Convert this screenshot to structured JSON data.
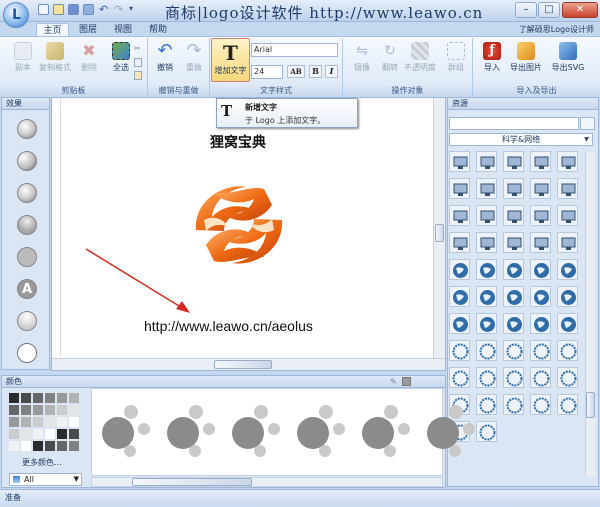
{
  "window": {
    "title": "商标|logo设计软件  http://www.leawo.cn",
    "app_logo_letter": "L",
    "quick_access": [
      "new-icon",
      "open-icon",
      "save-icon",
      "save-as-icon",
      "undo-icon",
      "redo-icon",
      "dropdown-icon"
    ],
    "buttons": {
      "minimize": "–",
      "maximize": "□",
      "close": "✕"
    }
  },
  "ribbon_tabs": [
    "主页",
    "图层",
    "视图",
    "帮助"
  ],
  "active_tab": "主页",
  "help_link": "了解硕思Logo设计师",
  "ribbon": {
    "clipboard": {
      "label": "剪贴板",
      "copy": "副本",
      "format_paint": "复制格式",
      "delete": "删除",
      "select_all": "全选"
    },
    "undo_redo": {
      "label": "撤销与重做",
      "undo": "撤销",
      "redo": "重做"
    },
    "text_style": {
      "label": "文字样式",
      "add_text": "增加文字",
      "font": "Arial",
      "size": "24",
      "ab": "AB",
      "bold": "B",
      "italic": "I"
    },
    "operate": {
      "label": "操作对象",
      "mirror": "镜像",
      "flip": "翻转",
      "opacity": "不透明度",
      "group": "群组"
    },
    "import_export": {
      "label": "导入及导出",
      "import": "导入",
      "export_image": "导出图片",
      "export_svg": "导出SVG"
    }
  },
  "tooltip": {
    "title": "新增文字",
    "desc": "于 Logo 上添加文字。"
  },
  "effects_panel": {
    "title": "效果",
    "pin": "▫"
  },
  "canvas": {
    "heading": "狸窝宝典",
    "url": "http://www.leawo.cn/aeolus"
  },
  "resources_panel": {
    "title": "资源",
    "category": "科学&网络",
    "search_placeholder": ""
  },
  "color_panel": {
    "title": "颜色",
    "more_colors": "更多颜色...",
    "filter": "All"
  },
  "status": {
    "text": "准备"
  },
  "colors": {
    "accent_red": "#d12b23",
    "ribbon_blue": "#c4d8f0",
    "logo_orange": "#f06a14"
  }
}
